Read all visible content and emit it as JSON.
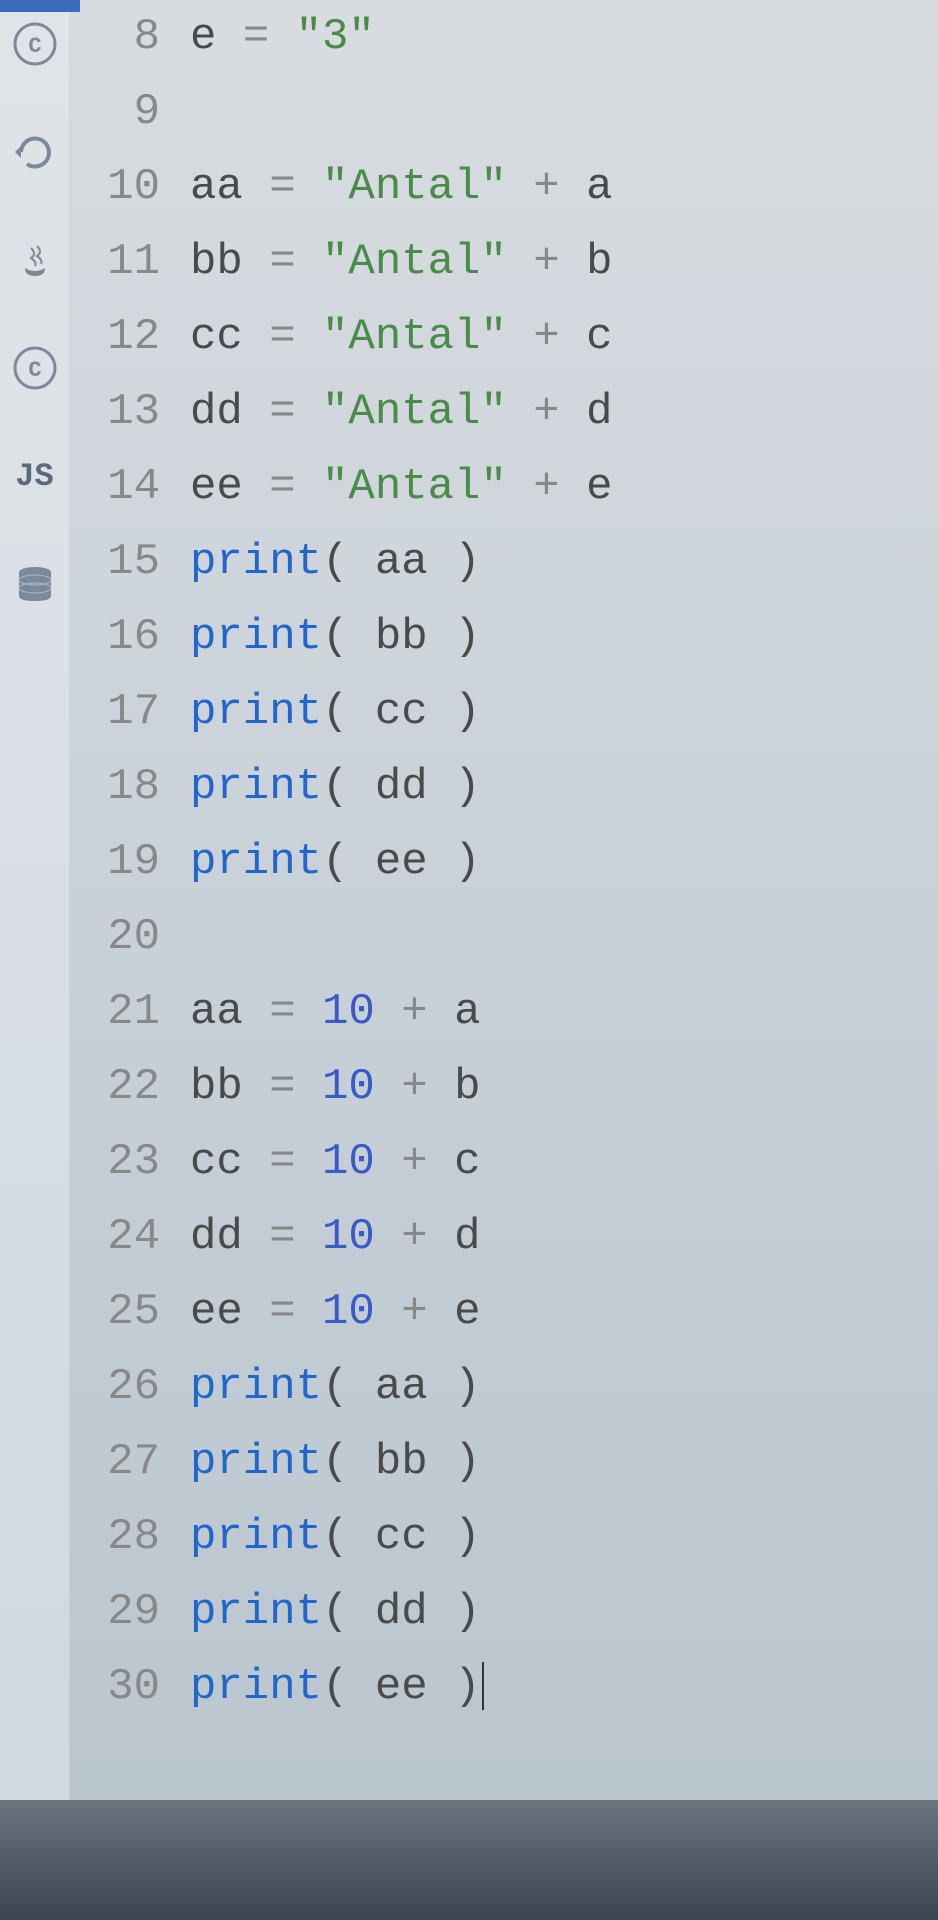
{
  "sidebar": {
    "items": [
      {
        "name": "c-icon-1",
        "type": "icon"
      },
      {
        "name": "c-icon-2",
        "type": "icon"
      },
      {
        "name": "java-icon",
        "type": "icon"
      },
      {
        "name": "c-icon-3",
        "type": "icon"
      },
      {
        "name": "js-label",
        "type": "text",
        "label": "JS"
      },
      {
        "name": "database-icon",
        "type": "icon"
      }
    ]
  },
  "code": {
    "lines": [
      {
        "num": 8,
        "tokens": [
          {
            "t": "var",
            "v": "e"
          },
          {
            "t": "sp",
            "v": " "
          },
          {
            "t": "op",
            "v": "="
          },
          {
            "t": "sp",
            "v": " "
          },
          {
            "t": "str",
            "v": "\"3\""
          }
        ]
      },
      {
        "num": 9,
        "tokens": []
      },
      {
        "num": 10,
        "tokens": [
          {
            "t": "var",
            "v": "aa"
          },
          {
            "t": "sp",
            "v": " "
          },
          {
            "t": "op",
            "v": "="
          },
          {
            "t": "sp",
            "v": " "
          },
          {
            "t": "str",
            "v": "\"Antal\""
          },
          {
            "t": "sp",
            "v": " "
          },
          {
            "t": "op",
            "v": "+"
          },
          {
            "t": "sp",
            "v": " "
          },
          {
            "t": "var",
            "v": "a"
          }
        ]
      },
      {
        "num": 11,
        "tokens": [
          {
            "t": "var",
            "v": "bb"
          },
          {
            "t": "sp",
            "v": " "
          },
          {
            "t": "op",
            "v": "="
          },
          {
            "t": "sp",
            "v": " "
          },
          {
            "t": "str",
            "v": "\"Antal\""
          },
          {
            "t": "sp",
            "v": " "
          },
          {
            "t": "op",
            "v": "+"
          },
          {
            "t": "sp",
            "v": " "
          },
          {
            "t": "var",
            "v": "b"
          }
        ]
      },
      {
        "num": 12,
        "tokens": [
          {
            "t": "var",
            "v": "cc"
          },
          {
            "t": "sp",
            "v": " "
          },
          {
            "t": "op",
            "v": "="
          },
          {
            "t": "sp",
            "v": " "
          },
          {
            "t": "str",
            "v": "\"Antal\""
          },
          {
            "t": "sp",
            "v": " "
          },
          {
            "t": "op",
            "v": "+"
          },
          {
            "t": "sp",
            "v": " "
          },
          {
            "t": "var",
            "v": "c"
          }
        ]
      },
      {
        "num": 13,
        "tokens": [
          {
            "t": "var",
            "v": "dd"
          },
          {
            "t": "sp",
            "v": " "
          },
          {
            "t": "op",
            "v": "="
          },
          {
            "t": "sp",
            "v": " "
          },
          {
            "t": "str",
            "v": "\"Antal\""
          },
          {
            "t": "sp",
            "v": " "
          },
          {
            "t": "op",
            "v": "+"
          },
          {
            "t": "sp",
            "v": " "
          },
          {
            "t": "var",
            "v": "d"
          }
        ]
      },
      {
        "num": 14,
        "tokens": [
          {
            "t": "var",
            "v": "ee"
          },
          {
            "t": "sp",
            "v": " "
          },
          {
            "t": "op",
            "v": "="
          },
          {
            "t": "sp",
            "v": " "
          },
          {
            "t": "str",
            "v": "\"Antal\""
          },
          {
            "t": "sp",
            "v": " "
          },
          {
            "t": "op",
            "v": "+"
          },
          {
            "t": "sp",
            "v": " "
          },
          {
            "t": "var",
            "v": "e"
          }
        ]
      },
      {
        "num": 15,
        "tokens": [
          {
            "t": "func",
            "v": "print"
          },
          {
            "t": "paren",
            "v": "("
          },
          {
            "t": "sp",
            "v": " "
          },
          {
            "t": "var",
            "v": "aa"
          },
          {
            "t": "sp",
            "v": " "
          },
          {
            "t": "paren",
            "v": ")"
          }
        ]
      },
      {
        "num": 16,
        "tokens": [
          {
            "t": "func",
            "v": "print"
          },
          {
            "t": "paren",
            "v": "("
          },
          {
            "t": "sp",
            "v": " "
          },
          {
            "t": "var",
            "v": "bb"
          },
          {
            "t": "sp",
            "v": " "
          },
          {
            "t": "paren",
            "v": ")"
          }
        ]
      },
      {
        "num": 17,
        "tokens": [
          {
            "t": "func",
            "v": "print"
          },
          {
            "t": "paren",
            "v": "("
          },
          {
            "t": "sp",
            "v": " "
          },
          {
            "t": "var",
            "v": "cc"
          },
          {
            "t": "sp",
            "v": " "
          },
          {
            "t": "paren",
            "v": ")"
          }
        ]
      },
      {
        "num": 18,
        "tokens": [
          {
            "t": "func",
            "v": "print"
          },
          {
            "t": "paren",
            "v": "("
          },
          {
            "t": "sp",
            "v": " "
          },
          {
            "t": "var",
            "v": "dd"
          },
          {
            "t": "sp",
            "v": " "
          },
          {
            "t": "paren",
            "v": ")"
          }
        ]
      },
      {
        "num": 19,
        "tokens": [
          {
            "t": "func",
            "v": "print"
          },
          {
            "t": "paren",
            "v": "("
          },
          {
            "t": "sp",
            "v": " "
          },
          {
            "t": "var",
            "v": "ee"
          },
          {
            "t": "sp",
            "v": " "
          },
          {
            "t": "paren",
            "v": ")"
          }
        ]
      },
      {
        "num": 20,
        "tokens": []
      },
      {
        "num": 21,
        "tokens": [
          {
            "t": "var",
            "v": "aa"
          },
          {
            "t": "sp",
            "v": " "
          },
          {
            "t": "op",
            "v": "="
          },
          {
            "t": "sp",
            "v": " "
          },
          {
            "t": "num",
            "v": "10"
          },
          {
            "t": "sp",
            "v": " "
          },
          {
            "t": "op",
            "v": "+"
          },
          {
            "t": "sp",
            "v": " "
          },
          {
            "t": "var",
            "v": "a"
          }
        ]
      },
      {
        "num": 22,
        "tokens": [
          {
            "t": "var",
            "v": "bb"
          },
          {
            "t": "sp",
            "v": " "
          },
          {
            "t": "op",
            "v": "="
          },
          {
            "t": "sp",
            "v": " "
          },
          {
            "t": "num",
            "v": "10"
          },
          {
            "t": "sp",
            "v": " "
          },
          {
            "t": "op",
            "v": "+"
          },
          {
            "t": "sp",
            "v": " "
          },
          {
            "t": "var",
            "v": "b"
          }
        ]
      },
      {
        "num": 23,
        "tokens": [
          {
            "t": "var",
            "v": "cc"
          },
          {
            "t": "sp",
            "v": " "
          },
          {
            "t": "op",
            "v": "="
          },
          {
            "t": "sp",
            "v": " "
          },
          {
            "t": "num",
            "v": "10"
          },
          {
            "t": "sp",
            "v": " "
          },
          {
            "t": "op",
            "v": "+"
          },
          {
            "t": "sp",
            "v": " "
          },
          {
            "t": "var",
            "v": "c"
          }
        ]
      },
      {
        "num": 24,
        "tokens": [
          {
            "t": "var",
            "v": "dd"
          },
          {
            "t": "sp",
            "v": " "
          },
          {
            "t": "op",
            "v": "="
          },
          {
            "t": "sp",
            "v": " "
          },
          {
            "t": "num",
            "v": "10"
          },
          {
            "t": "sp",
            "v": " "
          },
          {
            "t": "op",
            "v": "+"
          },
          {
            "t": "sp",
            "v": " "
          },
          {
            "t": "var",
            "v": "d"
          }
        ]
      },
      {
        "num": 25,
        "tokens": [
          {
            "t": "var",
            "v": "ee"
          },
          {
            "t": "sp",
            "v": " "
          },
          {
            "t": "op",
            "v": "="
          },
          {
            "t": "sp",
            "v": " "
          },
          {
            "t": "num",
            "v": "10"
          },
          {
            "t": "sp",
            "v": " "
          },
          {
            "t": "op",
            "v": "+"
          },
          {
            "t": "sp",
            "v": " "
          },
          {
            "t": "var",
            "v": "e"
          }
        ]
      },
      {
        "num": 26,
        "tokens": [
          {
            "t": "func",
            "v": "print"
          },
          {
            "t": "paren",
            "v": "("
          },
          {
            "t": "sp",
            "v": " "
          },
          {
            "t": "var",
            "v": "aa"
          },
          {
            "t": "sp",
            "v": " "
          },
          {
            "t": "paren",
            "v": ")"
          }
        ]
      },
      {
        "num": 27,
        "tokens": [
          {
            "t": "func",
            "v": "print"
          },
          {
            "t": "paren",
            "v": "("
          },
          {
            "t": "sp",
            "v": " "
          },
          {
            "t": "var",
            "v": "bb"
          },
          {
            "t": "sp",
            "v": " "
          },
          {
            "t": "paren",
            "v": ")"
          }
        ]
      },
      {
        "num": 28,
        "tokens": [
          {
            "t": "func",
            "v": "print"
          },
          {
            "t": "paren",
            "v": "("
          },
          {
            "t": "sp",
            "v": " "
          },
          {
            "t": "var",
            "v": "cc"
          },
          {
            "t": "sp",
            "v": " "
          },
          {
            "t": "paren",
            "v": ")"
          }
        ]
      },
      {
        "num": 29,
        "tokens": [
          {
            "t": "func",
            "v": "print"
          },
          {
            "t": "paren",
            "v": "("
          },
          {
            "t": "sp",
            "v": " "
          },
          {
            "t": "var",
            "v": "dd"
          },
          {
            "t": "sp",
            "v": " "
          },
          {
            "t": "paren",
            "v": ")"
          }
        ]
      },
      {
        "num": 30,
        "tokens": [
          {
            "t": "func",
            "v": "print"
          },
          {
            "t": "paren",
            "v": "("
          },
          {
            "t": "sp",
            "v": " "
          },
          {
            "t": "var",
            "v": "ee"
          },
          {
            "t": "sp",
            "v": " "
          },
          {
            "t": "paren",
            "v": ")"
          }
        ],
        "cursor": true
      }
    ]
  }
}
